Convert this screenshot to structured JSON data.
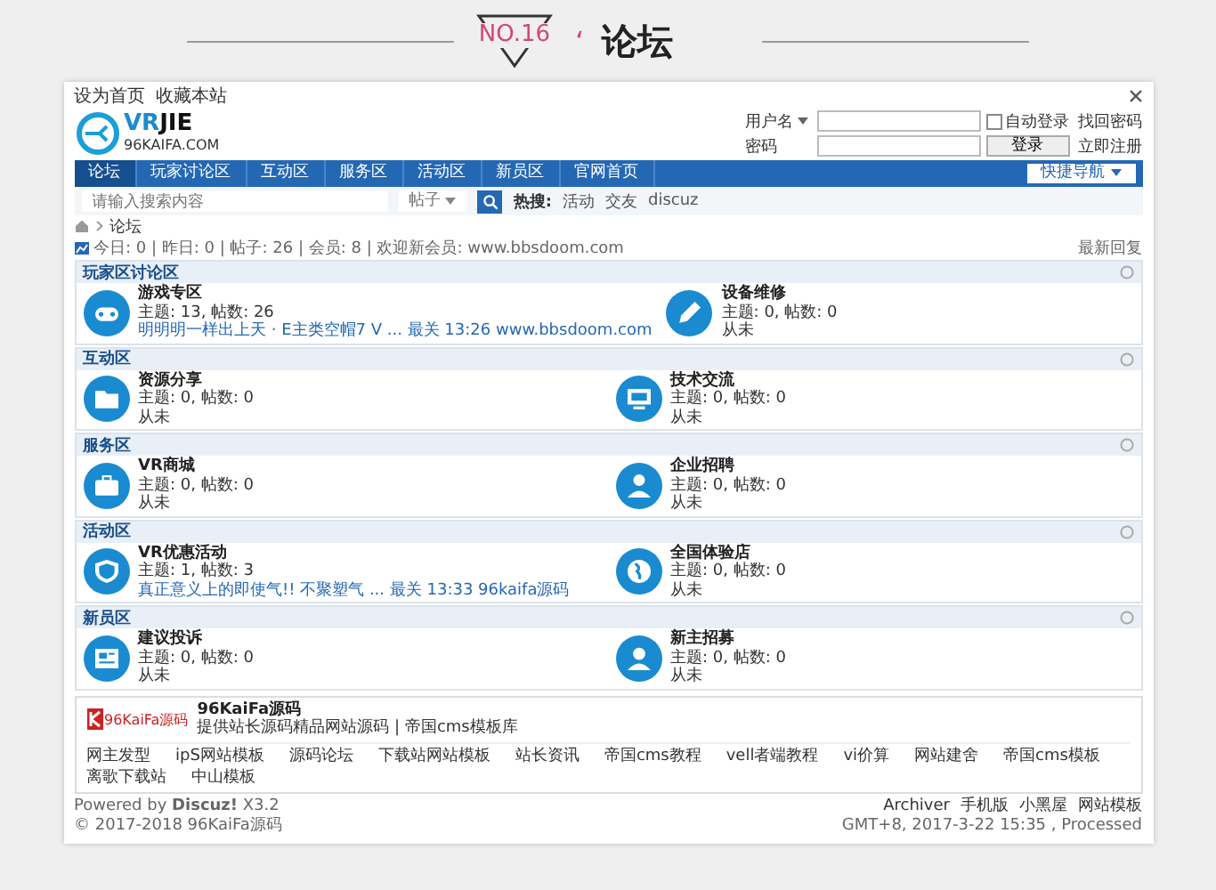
{
  "header": {
    "number": "NO.16",
    "quote": "‘",
    "title": "论坛"
  },
  "topbar": {
    "links": [
      "设为首页",
      "收藏本站"
    ]
  },
  "login": {
    "username_label": "用户名",
    "password_label": "密码",
    "remember": {
      "label": "自动登录",
      "checked": false
    },
    "forgot": "找回密码",
    "login_button": "登录",
    "register": "立即注册"
  },
  "logo": {
    "mark": "VR",
    "name": "JIE",
    "site": "96KAIFA.COM"
  },
  "nav": {
    "items": [
      {
        "label": "论坛",
        "selected": true
      },
      {
        "label": "玩家讨论区",
        "selected": false
      },
      {
        "label": "互动区",
        "selected": false
      },
      {
        "label": "服务区",
        "selected": false
      },
      {
        "label": "活动区",
        "selected": false
      },
      {
        "label": "新员区",
        "selected": false
      },
      {
        "label": "官网首页",
        "selected": false
      }
    ],
    "quick_nav": "快捷导航"
  },
  "search": {
    "placeholder": "请输入搜索内容",
    "scope": "帖子",
    "hot_label": "热搜:",
    "hot": [
      "活动",
      "交友",
      "discuz"
    ]
  },
  "breadcrumb": "论坛",
  "stats": "今日: 0 | 昨日: 0 | 帖子: 26 | 会员: 8 | 欢迎新会员: www.bbsdoom.com",
  "latest": "最新回复",
  "sections": [
    {
      "title": "玩家区讨论区",
      "forums": [
        {
          "name": "游戏专区",
          "counts": "主题: 13, 帖数: 26",
          "last": "明明明一样出上天 · E主类空帽7 V ... 最关 13:26 www.bbsdoom.com",
          "has_link": true
        },
        {
          "name": "设备维修",
          "counts": "主题: 0, 帖数: 0",
          "last": "从未",
          "has_link": false
        }
      ]
    },
    {
      "title": "互动区",
      "forums": [
        {
          "name": "资源分享",
          "counts": "主题: 0, 帖数: 0",
          "last": "从未",
          "has_link": false
        },
        {
          "name": "技术交流",
          "counts": "主题: 0, 帖数: 0",
          "last": "从未",
          "has_link": false
        }
      ]
    },
    {
      "title": "服务区",
      "forums": [
        {
          "name": "VR商城",
          "counts": "主题: 0, 帖数: 0",
          "last": "从未",
          "has_link": false
        },
        {
          "name": "企业招聘",
          "counts": "主题: 0, 帖数: 0",
          "last": "从未",
          "has_link": false
        }
      ]
    },
    {
      "title": "活动区",
      "forums": [
        {
          "name": "VR优惠活动",
          "counts": "主题: 1, 帖数: 3",
          "last": "真正意义上的即使气!! 不聚塑气 ... 最关 13:33 96kaifa源码",
          "has_link": true
        },
        {
          "name": "全国体验店",
          "counts": "主题: 0, 帖数: 0",
          "last": "从未",
          "has_link": false
        }
      ]
    },
    {
      "title": "新员区",
      "forums": [
        {
          "name": "建议投诉",
          "counts": "主题: 0, 帖数: 0",
          "last": "从未",
          "has_link": false
        },
        {
          "name": "新主招募",
          "counts": "主题: 0, 帖数: 0",
          "last": "从未",
          "has_link": false
        }
      ]
    }
  ],
  "friend": {
    "logo_text": "96KaiFa源码",
    "name": "96KaiFa源码",
    "description": "提供站长源码精品网站源码 | 帝国cms模板库"
  },
  "links": [
    "网主发型",
    "ipS网站模板",
    "源码论坛",
    "下载站网站模板",
    "站长资讯",
    "帝国cms教程",
    "vell者端教程",
    "vi价算",
    "网站建舍",
    "帝国cms模板",
    "离歌下载站",
    "中山模板"
  ],
  "footer": {
    "powered": "Powered by **Discuz!** X3.2",
    "copyright": "© 2017-2018 96KaiFa源码",
    "links": [
      "Archiver",
      "手机版",
      "小黑屋",
      "网站模板"
    ],
    "time": "GMT+8, 2017-3-22 15:35 , Processed"
  }
}
